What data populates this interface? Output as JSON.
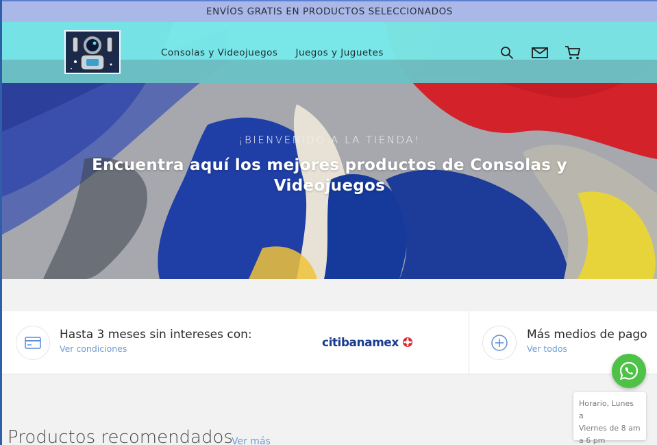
{
  "announcement": {
    "text": "ENVÍOS GRATIS EN PRODUCTOS SELECCIONADOS"
  },
  "header": {
    "nav": [
      {
        "label": "Consolas y Videojuegos"
      },
      {
        "label": "Juegos y Juguetes"
      }
    ],
    "icons": [
      "search-icon",
      "mail-icon",
      "cart-icon"
    ]
  },
  "hero": {
    "kicker": "¡BIENVENIDO A LA TIENDA!",
    "title_line1": "Encuentra aquí los mejores productos de Consolas y",
    "title_line2": "Videojuegos"
  },
  "payments": {
    "installments": {
      "title": "Hasta 3 meses sin intereses con:",
      "link": "Ver condiciones",
      "bank_logo_text": "citibanamex"
    },
    "more": {
      "title": "Más medios de pago",
      "link": "Ver todos"
    }
  },
  "whatsapp": {
    "tooltip_line1": "Horario, Lunes a",
    "tooltip_line2": "Viernes de 8 am",
    "tooltip_line3": "a 6 pm"
  },
  "section": {
    "title": "Productos recomendados",
    "link": "Ver más"
  },
  "colors": {
    "announcement_bg": "#a9b8e6",
    "navbar_bg": "#78e8e8",
    "accent_link": "#6d9ad4",
    "whatsapp_green": "#4dc247"
  }
}
